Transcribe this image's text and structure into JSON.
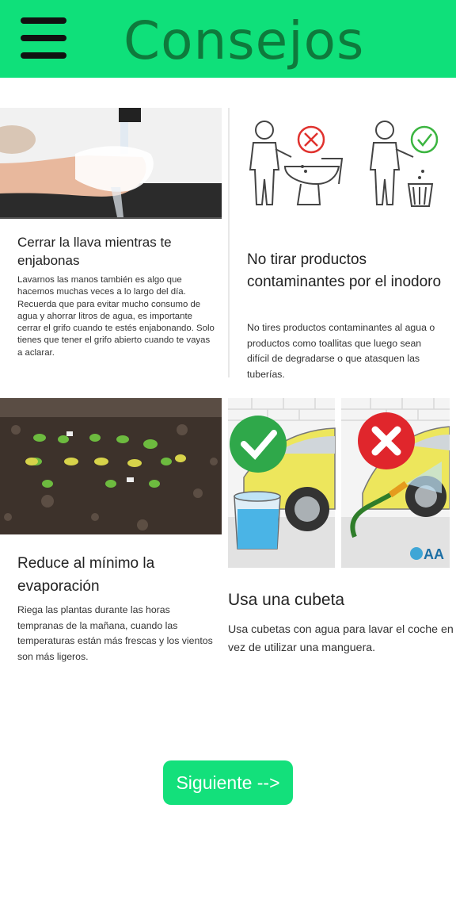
{
  "header": {
    "title": "Consejos",
    "menu_icon": "hamburger-menu-icon"
  },
  "cards": [
    {
      "title": "Cerrar la llava mientras te enjabonas",
      "text": "Lavarnos las manos también es algo que hacemos muchas veces a lo largo del día. Recuerda que para evitar mucho consumo de agua y ahorrar litros de agua, es importante cerrar el grifo cuando te estés enjabonando. Solo tienes que tener el grifo abierto cuando te vayas a aclarar."
    },
    {
      "title": "No tirar productos contaminantes por el inodoro",
      "text": "No tires productos contaminantes al agua o productos como toallitas que luego sean difícil de degradarse o que atasquen las tuberías."
    },
    {
      "title": "Reduce al mínimo la evaporación",
      "text": "Riega las plantas durante las horas tempranas de la mañana, cuando las temperaturas están más frescas y los vientos son más ligeros."
    },
    {
      "title": "Usa una cubeta",
      "text": "Usa cubetas con agua para lavar el coche en vez de utilizar una manguera.",
      "image_logo": "AA"
    }
  ],
  "next_button": {
    "label": "Siguiente -->"
  },
  "colors": {
    "header_bg": "#0fe07a",
    "title": "#0e7a3c",
    "button_bg": "#13e07b"
  }
}
